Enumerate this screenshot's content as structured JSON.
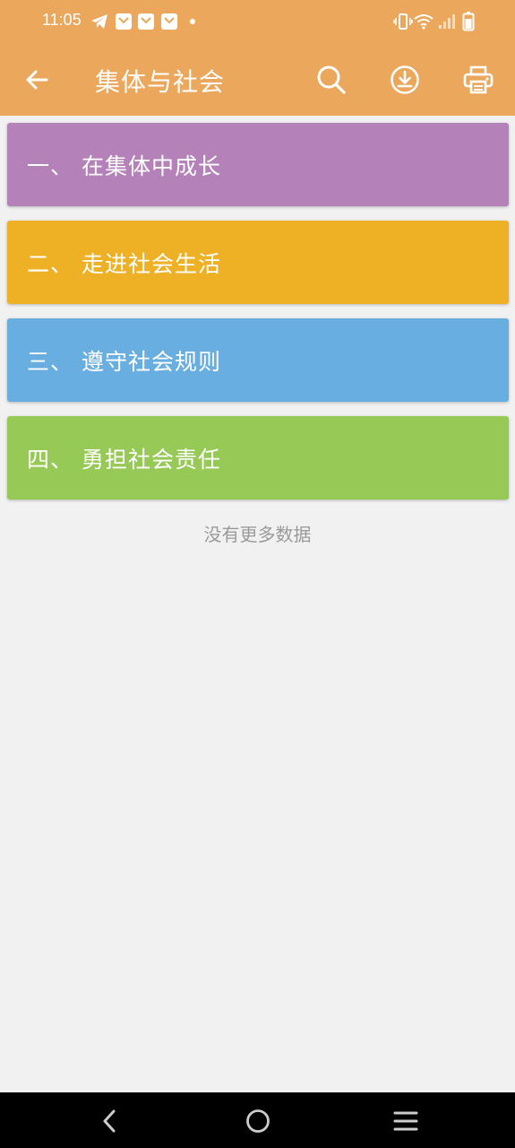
{
  "status_bar": {
    "time": "11:05",
    "icons": [
      "telegram-icon",
      "mail-icon",
      "mail-icon",
      "mail-icon",
      "dot-icon",
      "vibrate-icon",
      "wifi-icon",
      "signal-icon",
      "battery-icon"
    ]
  },
  "app_bar": {
    "title": "集体与社会",
    "background": "#eba75b",
    "actions": [
      "search-icon",
      "download-icon",
      "print-icon"
    ]
  },
  "list": {
    "items": [
      {
        "label": "一、 在集体中成长",
        "color": "#b482b9"
      },
      {
        "label": "二、 走进社会生活",
        "color": "#eeb024"
      },
      {
        "label": "三、 遵守社会规则",
        "color": "#69aee0"
      },
      {
        "label": "四、 勇担社会责任",
        "color": "#97c957"
      }
    ],
    "footer": "没有更多数据"
  },
  "nav_bar": {
    "buttons": [
      "back-nav-icon",
      "home-nav-icon",
      "menu-nav-icon"
    ]
  }
}
